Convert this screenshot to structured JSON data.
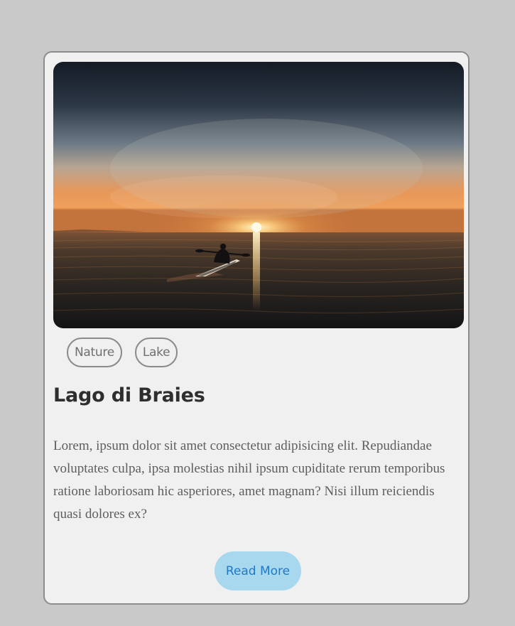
{
  "card": {
    "image": {
      "alt": "Kayaker paddling on a lake at sunset"
    },
    "tags": [
      "Nature",
      "Lake"
    ],
    "title": "Lago di Braies",
    "description": "Lorem, ipsum dolor sit amet consectetur adipisicing elit. Repudiandae voluptates culpa, ipsa molestias nihil ipsum cupiditate rerum temporibus ratione laboriosam hic asperiores, amet magnam? Nisi illum reiciendis quasi dolores ex?",
    "button_label": "Read More"
  },
  "colors": {
    "page_background": "#c9c9c9",
    "card_background": "#f0f0f0",
    "button_background": "#a8d8ee",
    "button_text": "#1f7ac6"
  }
}
